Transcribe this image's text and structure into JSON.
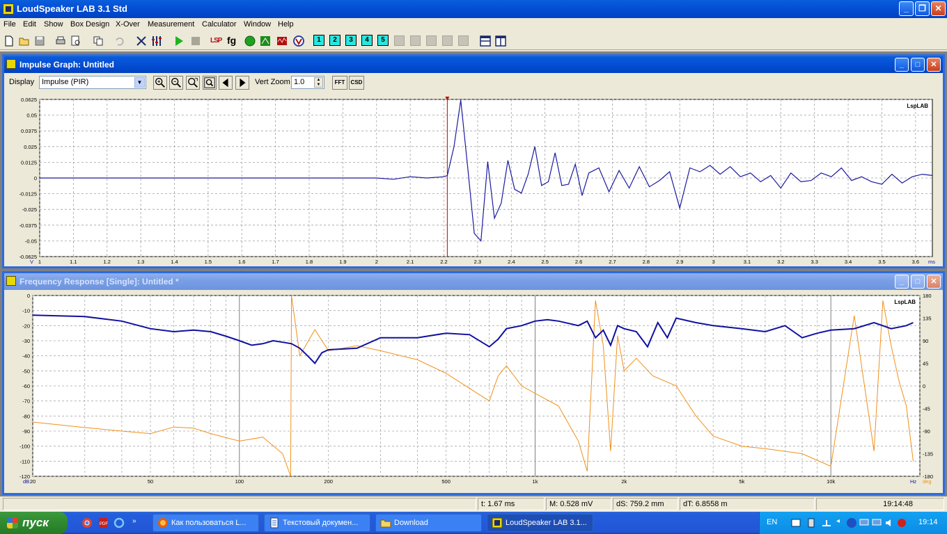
{
  "app": {
    "title": "LoudSpeaker LAB 3.1 Std"
  },
  "menu": [
    "File",
    "Edit",
    "Show",
    "Box Design",
    "X-Over",
    "Measurement",
    "Calculator",
    "Window",
    "Help"
  ],
  "toolbar": {
    "numbered_buttons": [
      "1",
      "2",
      "3",
      "4",
      "5"
    ],
    "lsp_label": "LSP",
    "fg_label": "fg"
  },
  "impulse_window": {
    "title": "Impulse Graph: Untitled",
    "display_label": "Display",
    "display_value": "Impulse (PIR)",
    "vert_zoom_label": "Vert Zoom",
    "vert_zoom_value": "1.0",
    "fft_label": "FFT",
    "csd_label": "CSD",
    "brand": "LspLAB",
    "y_unit": "V",
    "x_unit": "ms",
    "y_ticks": [
      "0.0625",
      "0.05",
      "0.0375",
      "0.025",
      "0.0125",
      "0",
      "-0.0125",
      "-0.025",
      "-0.0375",
      "-0.05",
      "-0.0625"
    ],
    "x_ticks": [
      "1",
      "1.1",
      "1.2",
      "1.3",
      "1.4",
      "1.5",
      "1.6",
      "1.7",
      "1.8",
      "1.9",
      "2",
      "2.1",
      "2.2",
      "2.3",
      "2.4",
      "2.5",
      "2.6",
      "2.7",
      "2.8",
      "2.9",
      "3",
      "3.1",
      "3.2",
      "3.3",
      "3.4",
      "3.5",
      "3.6"
    ],
    "marker_ms": 2.21,
    "line_color": "#1A1AA0",
    "marker_color": "#C00000"
  },
  "frequency_window": {
    "title": "Frequency Response [Single]: Untitled *",
    "brand": "LspLAB",
    "y_unit": "dB",
    "x_unit": "Hz",
    "phase_unit": "deg",
    "y_ticks": [
      "0",
      "-10",
      "-20",
      "-30",
      "-40",
      "-50",
      "-60",
      "-70",
      "-80",
      "-90",
      "-100",
      "-110",
      "-120"
    ],
    "phase_ticks": [
      "180",
      "135",
      "90",
      "45",
      "0",
      "-45",
      "-90",
      "-135",
      "-180"
    ],
    "x_ticks": [
      "20",
      "50",
      "100",
      "200",
      "500",
      "1k",
      "2k",
      "5k",
      "10k"
    ],
    "magnitude_color": "#1010A0",
    "phase_color": "#F0901A"
  },
  "chart_data": [
    {
      "type": "line",
      "x_range_ms": [
        1.0,
        3.65
      ],
      "ylim": [
        -0.0625,
        0.0625
      ],
      "series": [
        {
          "x": [
            1.0,
            2.0,
            2.05,
            2.1,
            2.15,
            2.2,
            2.21,
            2.23,
            2.25,
            2.27,
            2.29,
            2.31,
            2.33,
            2.35,
            2.37,
            2.39,
            2.41,
            2.43,
            2.45,
            2.47,
            2.49,
            2.51,
            2.53,
            2.55,
            2.57,
            2.59,
            2.61,
            2.63,
            2.66,
            2.69,
            2.72,
            2.75,
            2.78,
            2.81,
            2.84,
            2.87,
            2.9,
            2.93,
            2.96,
            2.99,
            3.02,
            3.05,
            3.08,
            3.11,
            3.14,
            3.17,
            3.2,
            3.23,
            3.26,
            3.29,
            3.32,
            3.35,
            3.38,
            3.41,
            3.44,
            3.47,
            3.5,
            3.53,
            3.56,
            3.59,
            3.62,
            3.65
          ],
          "y": [
            0,
            0,
            -0.001,
            0.001,
            0,
            0.001,
            0.002,
            0.025,
            0.062,
            0.01,
            -0.044,
            -0.05,
            0.013,
            -0.032,
            -0.02,
            0.014,
            -0.009,
            -0.012,
            0.003,
            0.025,
            -0.006,
            -0.003,
            0.02,
            -0.006,
            -0.005,
            0.011,
            -0.014,
            0.004,
            0.008,
            -0.011,
            0.006,
            -0.008,
            0.009,
            -0.007,
            -0.002,
            0.005,
            -0.024,
            0.008,
            0.005,
            0.01,
            0.003,
            0.009,
            0.001,
            0.004,
            -0.003,
            0.002,
            -0.008,
            0.004,
            -0.003,
            -0.002,
            0.004,
            0.001,
            0.008,
            -0.002,
            0.001,
            -0.003,
            -0.005,
            0.003,
            -0.004,
            0.001,
            0.003,
            0.002
          ]
        }
      ]
    },
    {
      "type": "line",
      "x_scale": "log",
      "xlim": [
        20,
        20000
      ],
      "ylim": [
        -120,
        0
      ],
      "phase_lim": [
        -180,
        180
      ],
      "series": [
        {
          "x": [
            20,
            30,
            40,
            50,
            60,
            70,
            80,
            90,
            100,
            110,
            120,
            130,
            140,
            150,
            160,
            170,
            180,
            190,
            200,
            250,
            300,
            400,
            500,
            600,
            700,
            750,
            800,
            900,
            1000,
            1100,
            1200,
            1400,
            1500,
            1600,
            1700,
            1800,
            1900,
            2000,
            2200,
            2400,
            2600,
            2800,
            3000,
            3500,
            4000,
            5000,
            6000,
            7000,
            8000,
            9000,
            10000,
            12000,
            14000,
            16000,
            18000,
            19000
          ],
          "y": [
            -13,
            -14,
            -17,
            -22,
            -24,
            -23,
            -24,
            -27,
            -30,
            -33,
            -32,
            -30,
            -31,
            -32,
            -35,
            -40,
            -45,
            -38,
            -36,
            -35,
            -28,
            -28,
            -25,
            -26,
            -34,
            -29,
            -22,
            -20,
            -17,
            -16,
            -17,
            -20,
            -17,
            -28,
            -23,
            -33,
            -20,
            -22,
            -24,
            -34,
            -18,
            -28,
            -15,
            -18,
            -20,
            -22,
            -24,
            -20,
            -28,
            -25,
            -23,
            -22,
            -18,
            -22,
            -20,
            -18
          ]
        },
        {
          "x": [
            20,
            30,
            40,
            50,
            60,
            70,
            80,
            100,
            120,
            140,
            149,
            150,
            160,
            180,
            200,
            250,
            300,
            400,
            500,
            600,
            700,
            750,
            800,
            900,
            1000,
            1200,
            1400,
            1500,
            1600,
            1700,
            1800,
            1900,
            2000,
            2200,
            2500,
            3000,
            3500,
            4000,
            5000,
            6000,
            8000,
            10000,
            12000,
            14000,
            15000,
            16000,
            17000,
            18000,
            19000
          ],
          "y": [
            -72,
            -83,
            -90,
            -95,
            -82,
            -84,
            -95,
            -110,
            -102,
            -135,
            -180,
            180,
            60,
            112,
            70,
            80,
            70,
            52,
            25,
            -5,
            -30,
            20,
            40,
            0,
            -15,
            -40,
            -110,
            -170,
            170,
            80,
            -130,
            100,
            30,
            55,
            20,
            0,
            -60,
            -100,
            -120,
            -125,
            -135,
            -160,
            140,
            -130,
            170,
            80,
            10,
            -40,
            -150
          ]
        }
      ]
    }
  ],
  "status": {
    "t": "t: 1.67 ms",
    "m": "M: 0.528 mV",
    "ds": "dS: 759.2 mm",
    "dt": "dT: 6.8558 m",
    "clock": "19:14:48"
  },
  "taskbar": {
    "start": "пуск",
    "tasks": [
      "Как пользоваться L...",
      "Текстовый докумен...",
      "Download",
      "LoudSpeaker LAB 3.1..."
    ],
    "lang": "EN",
    "time": "19:14"
  }
}
